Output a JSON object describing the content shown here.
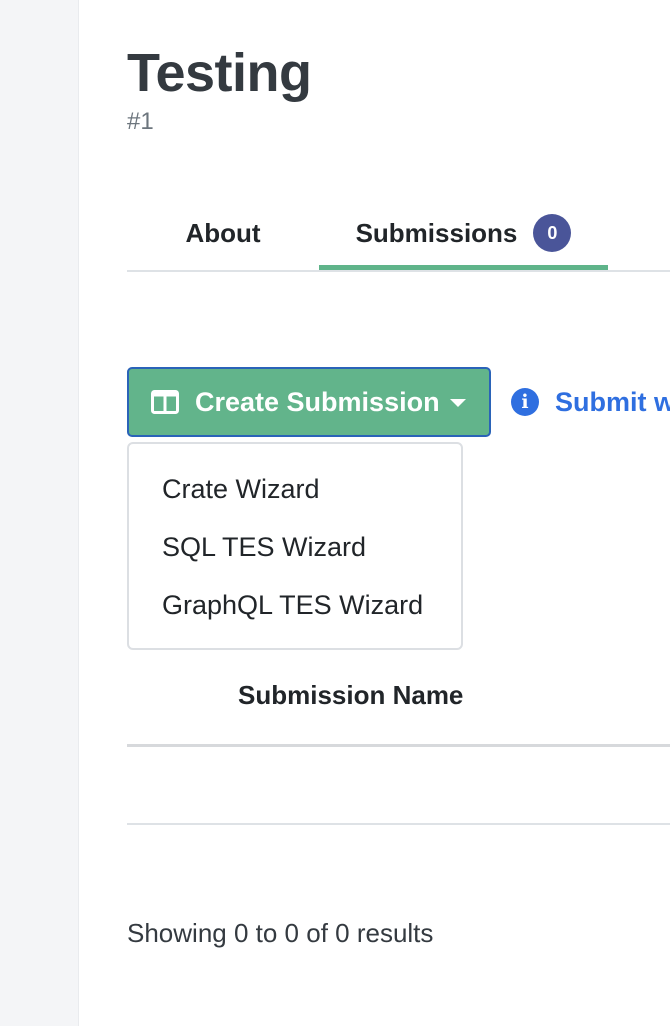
{
  "page": {
    "title": "Testing",
    "subtitle": "#1"
  },
  "tabs": [
    {
      "label": "About"
    },
    {
      "label": "Submissions",
      "badge": "0",
      "active": true
    }
  ],
  "actions": {
    "create_submission_label": "Create Submission",
    "submit_link_label": "Submit w",
    "info_icon_glyph": "i"
  },
  "dropdown": {
    "items": [
      {
        "label": "Crate Wizard"
      },
      {
        "label": "SQL TES Wizard"
      },
      {
        "label": "GraphQL TES Wizard"
      }
    ]
  },
  "table": {
    "columns": [
      "Submission Name"
    ],
    "rows": []
  },
  "pagination": {
    "summary": "Showing 0 to 0 of 0 results"
  },
  "colors": {
    "accent_green": "#62b48b",
    "tab_underline": "#5fb48a",
    "badge_bg": "#4a5599",
    "link_blue": "#2f6fe0",
    "focus_border": "#2a63b8"
  },
  "icons": {
    "create_button": "columns-icon",
    "submit_link": "info-circle-icon",
    "create_button_caret": "caret-down-icon"
  }
}
